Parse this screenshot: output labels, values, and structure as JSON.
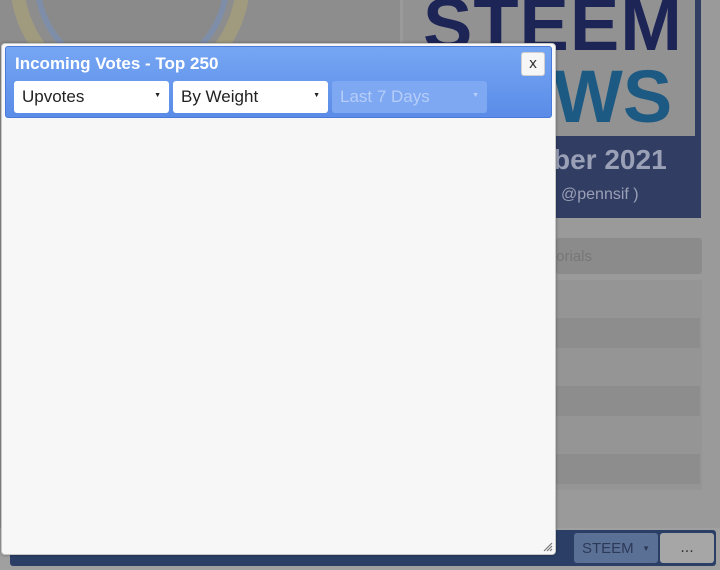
{
  "background": {
    "banner_title_line1": "STEEM",
    "banner_title_line2": "WS",
    "banner_date": "ber 2021",
    "banner_author": "@pennsif )",
    "tab_label": "torials",
    "footer_select_value": "STEEM",
    "footer_more_label": "..."
  },
  "dialog": {
    "title": "Incoming Votes - Top 250",
    "close_label": "x",
    "filters": {
      "vote_type": "Upvotes",
      "sort": "By Weight",
      "period": "Last 7 Days"
    }
  },
  "icons": {
    "caret": "caret-down-icon",
    "resize": "resize-handle-icon"
  },
  "colors": {
    "titlebar": "#5a8ce8",
    "dialog_bg": "#f7f7f7",
    "disabled_select": "#7fa8f2"
  }
}
